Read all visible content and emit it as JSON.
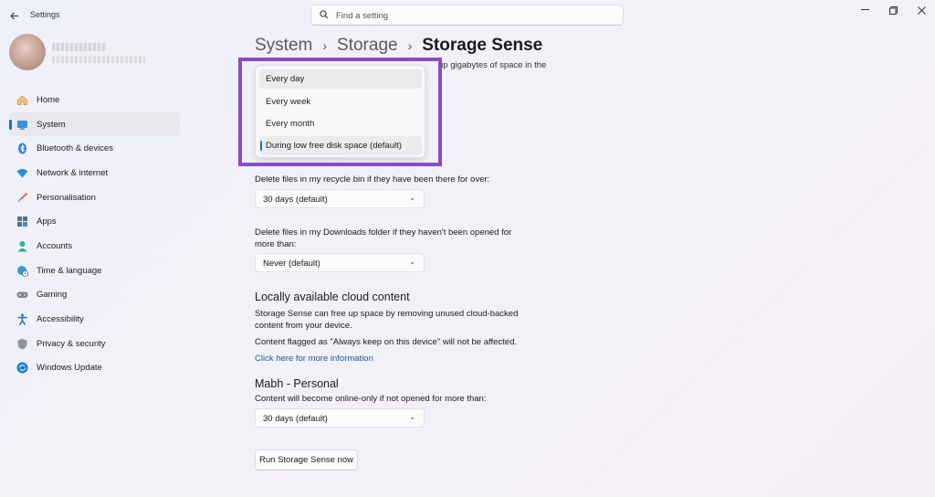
{
  "window": {
    "title": "Settings",
    "controls": [
      "minimize",
      "maximize",
      "close"
    ]
  },
  "search": {
    "placeholder": "Find a setting"
  },
  "sidebar": {
    "items": [
      {
        "label": "Home",
        "icon": "home-icon",
        "active": false
      },
      {
        "label": "System",
        "icon": "system-icon",
        "active": true
      },
      {
        "label": "Bluetooth & devices",
        "icon": "bluetooth-icon",
        "active": false
      },
      {
        "label": "Network & internet",
        "icon": "wifi-icon",
        "active": false
      },
      {
        "label": "Personalisation",
        "icon": "brush-icon",
        "active": false
      },
      {
        "label": "Apps",
        "icon": "apps-icon",
        "active": false
      },
      {
        "label": "Accounts",
        "icon": "person-icon",
        "active": false
      },
      {
        "label": "Time & language",
        "icon": "globe-clock-icon",
        "active": false
      },
      {
        "label": "Gaming",
        "icon": "gamepad-icon",
        "active": false
      },
      {
        "label": "Accessibility",
        "icon": "accessibility-icon",
        "active": false
      },
      {
        "label": "Privacy & security",
        "icon": "shield-icon",
        "active": false
      },
      {
        "label": "Windows Update",
        "icon": "update-icon",
        "active": false
      }
    ]
  },
  "header": {
    "crumb1": "System",
    "crumb2": "Storage",
    "current": "Storage Sense"
  },
  "partial_text": "up gigabytes of space in the",
  "run_menu": {
    "options": [
      {
        "label": "Every day",
        "state": "hover"
      },
      {
        "label": "Every week",
        "state": "normal"
      },
      {
        "label": "Every month",
        "state": "normal"
      },
      {
        "label": "During low free disk space (default)",
        "state": "selected"
      }
    ],
    "highlight_color": "#8a4bc3"
  },
  "recycle": {
    "label": "Delete files in my recycle bin if they have been there for over:",
    "value": "30 days (default)"
  },
  "downloads": {
    "label_line1": "Delete files in my Downloads folder if they haven't been opened for",
    "label_line2": "more than:",
    "value": "Never (default)"
  },
  "cloud": {
    "title": "Locally available cloud content",
    "desc_line1": "Storage Sense can free up space by removing unused cloud-backed",
    "desc_line2": "content from your device.",
    "note": "Content flagged as \"Always keep on this device\" will not be affected.",
    "link": "Click here for more information"
  },
  "onedrive": {
    "title": "Mabh - Personal",
    "label": "Content will become online-only if not opened for more than:",
    "value": "30 days (default)"
  },
  "run_button": "Run Storage Sense now",
  "colors": {
    "accent": "#1f6fc4",
    "link": "#0e5aa7"
  }
}
